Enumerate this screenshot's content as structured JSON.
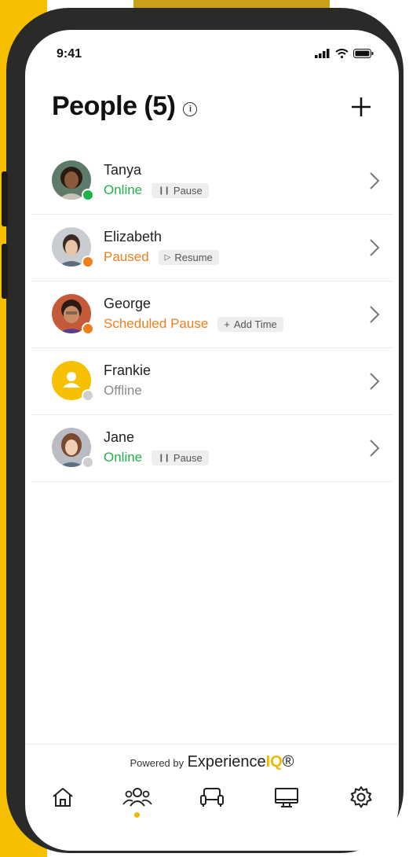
{
  "status_bar": {
    "time": "9:41"
  },
  "header": {
    "title": "People (5)",
    "info_glyph": "i"
  },
  "people": [
    {
      "name": "Tanya",
      "status": "Online",
      "status_color": "#1FB24A",
      "dot_color": "#1FB24A",
      "action": "Pause",
      "action_icon": "pause-icon",
      "avatar": "photo"
    },
    {
      "name": "Elizabeth",
      "status": "Paused",
      "status_color": "#F07E1C",
      "dot_color": "#F07E1C",
      "action": "Resume",
      "action_icon": "play-icon",
      "avatar": "photo"
    },
    {
      "name": "George",
      "status": "Scheduled Pause",
      "status_color": "#F07E1C",
      "dot_color": "#F07E1C",
      "action": "Add Time",
      "action_icon": "plus-icon",
      "avatar": "photo"
    },
    {
      "name": "Frankie",
      "status": "Offline",
      "status_color": "#8a8a8a",
      "dot_color": "#cfcfcf",
      "action": "",
      "action_icon": "",
      "avatar": "placeholder"
    },
    {
      "name": "Jane",
      "status": "Online",
      "status_color": "#1FB24A",
      "dot_color": "#cfcfcf",
      "action": "Pause",
      "action_icon": "pause-icon",
      "avatar": "photo"
    }
  ],
  "footer": {
    "powered_by": "Powered by",
    "brand_main": "Experience",
    "brand_accent": "IQ",
    "brand_mark": "®"
  },
  "nav": [
    {
      "icon": "home-icon",
      "active": false
    },
    {
      "icon": "people-icon",
      "active": true
    },
    {
      "icon": "furniture-icon",
      "active": false
    },
    {
      "icon": "monitor-icon",
      "active": false
    },
    {
      "icon": "settings-icon",
      "active": false
    }
  ],
  "colors": {
    "brand_yellow": "#F6BF00",
    "online": "#1FB24A",
    "paused": "#F07E1C"
  }
}
